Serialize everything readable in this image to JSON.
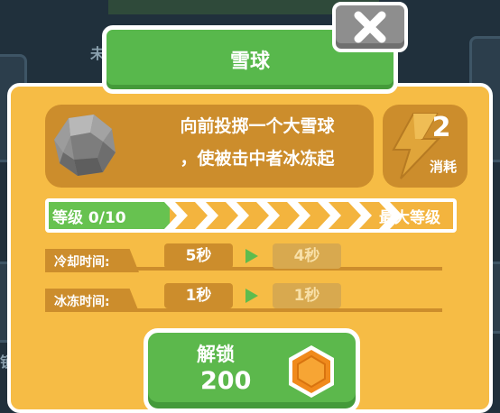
{
  "skill": {
    "title": "雪球",
    "description_line1": "向前投掷一个大雪球",
    "description_line2": "，使被击中者冰冻起",
    "cost_value": "2",
    "cost_label": "消耗"
  },
  "level": {
    "label": "等级 0/10",
    "max_label": "最大等级",
    "progress": 0.3
  },
  "stats": [
    {
      "label": "冷却时间:",
      "current": "5秒",
      "next": "4秒"
    },
    {
      "label": "冰冻时间:",
      "current": "1秒",
      "next": "1秒"
    }
  ],
  "unlock": {
    "label": "解锁",
    "price": "200"
  },
  "backdrop": {
    "left_char_top": "未",
    "left_char_bottom": "锁"
  },
  "icons": {
    "close": "close-x-icon",
    "skill": "snowball-rock-icon",
    "energy": "lightning-bolt-icon",
    "currency": "hexagon-coin-icon"
  },
  "colors": {
    "panel": "#f6bc45",
    "panel_dark": "#cc8d2c",
    "accent_green": "#5cb84c",
    "close_gray": "#8e8e8e"
  }
}
